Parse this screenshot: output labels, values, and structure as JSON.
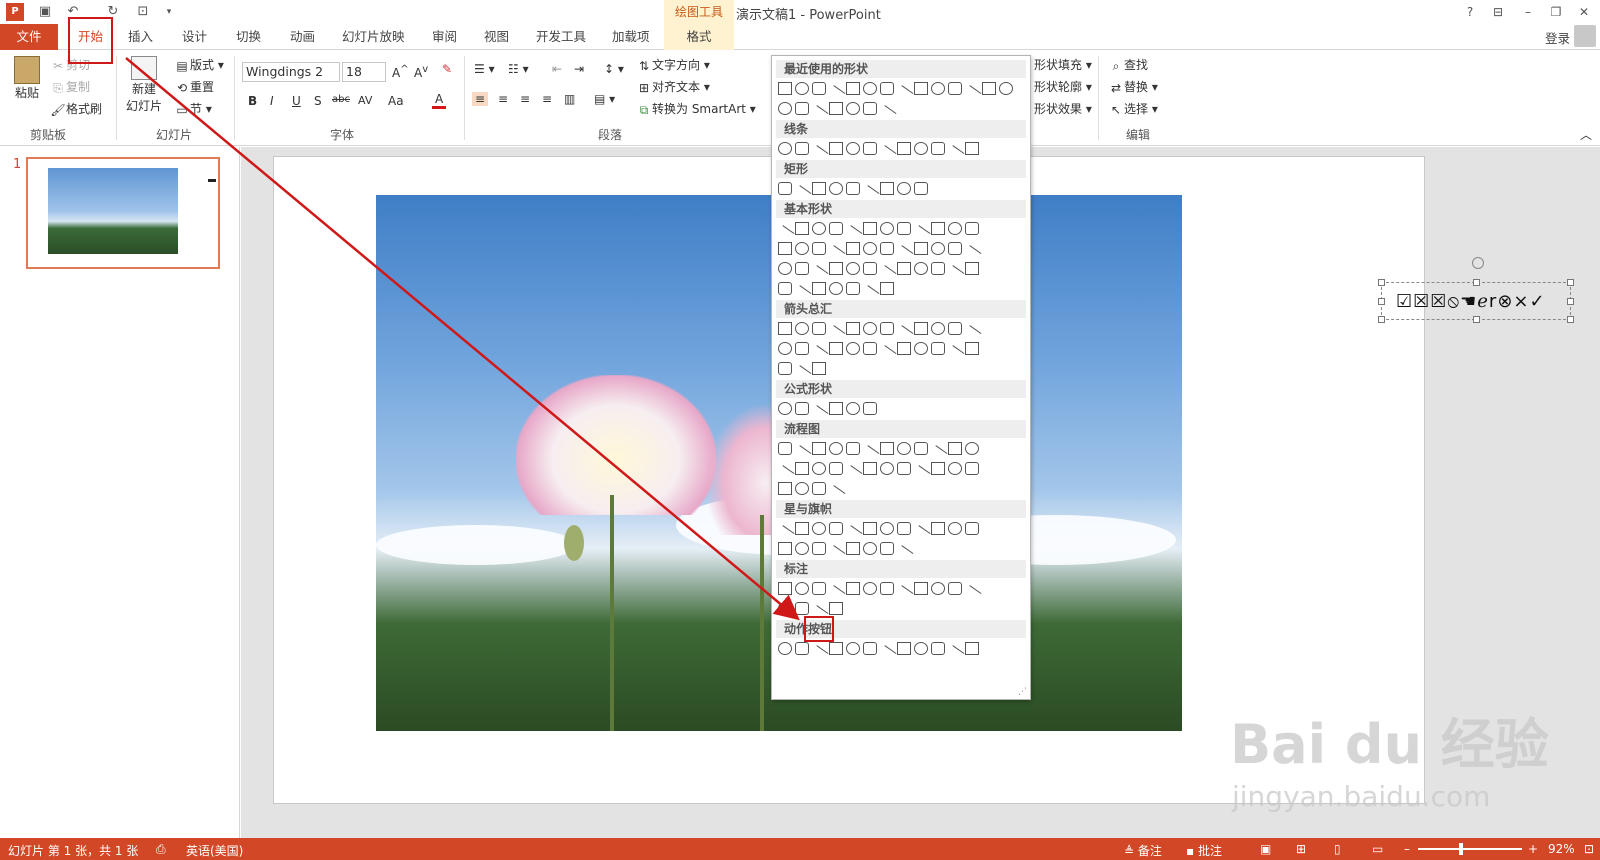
{
  "titlebar": {
    "drawing_tools": "绘图工具",
    "doc_title": "演示文稿1 - PowerPoint",
    "help": "?",
    "minimize": "–",
    "restore": "❐",
    "close": "✕"
  },
  "tabs": [
    "文件",
    "开始",
    "插入",
    "设计",
    "切换",
    "动画",
    "幻灯片放映",
    "审阅",
    "视图",
    "开发工具",
    "加载项",
    "格式"
  ],
  "login": "登录",
  "ribbon": {
    "clipboard": {
      "paste": "粘贴",
      "cut": "剪切",
      "copy": "复制",
      "format_painter": "格式刷",
      "label": "剪贴板"
    },
    "slides": {
      "new_slide": "新建",
      "new_slide2": "幻灯片",
      "layout": "版式",
      "reset": "重置",
      "section": "节",
      "label": "幻灯片"
    },
    "font": {
      "name": "Wingdings 2",
      "size": "18",
      "label": "字体",
      "buttons": [
        "B",
        "I",
        "U",
        "S",
        "abc",
        "AV",
        "Aa",
        "A"
      ]
    },
    "paragraph": {
      "label": "段落",
      "text_direction": "文字方向",
      "align_text": "对齐文本",
      "smartart": "转换为 SmartArt"
    },
    "drawing": {
      "shape_fill": "形状填充",
      "shape_outline": "形状轮廓",
      "shape_effects": "形状效果"
    },
    "editing": {
      "find": "查找",
      "replace": "替换",
      "select": "选择",
      "label": "编辑"
    }
  },
  "slide_panel": {
    "number": "1"
  },
  "textbox": {
    "symbols": "☑☒☒⦸☚ℯr⊗×✓"
  },
  "shapes_gallery": {
    "sections": [
      {
        "title": "最近使用的形状",
        "rows": [
          14,
          7
        ]
      },
      {
        "title": "线条",
        "rows": [
          12
        ]
      },
      {
        "title": "矩形",
        "rows": [
          9
        ]
      },
      {
        "title": "基本形状",
        "rows": [
          12,
          12,
          12,
          7
        ]
      },
      {
        "title": "箭头总汇",
        "rows": [
          12,
          12,
          3
        ]
      },
      {
        "title": "公式形状",
        "rows": [
          6
        ]
      },
      {
        "title": "流程图",
        "rows": [
          12,
          12,
          4
        ]
      },
      {
        "title": "星与旗帜",
        "rows": [
          12,
          8
        ]
      },
      {
        "title": "标注",
        "rows": [
          12,
          4
        ]
      },
      {
        "title": "动作按钮",
        "rows": [
          12
        ]
      }
    ]
  },
  "watermark": {
    "brand": "Bai du 经验",
    "url": "jingyan.baidu.com"
  },
  "statusbar": {
    "slide_info": "幻灯片 第 1 张，共 1 张",
    "language": "英语(美国)",
    "notes": "备注",
    "comments": "批注",
    "zoom": "92%"
  },
  "colors": {
    "accent": "#d24726",
    "annotation": "#d01818"
  }
}
